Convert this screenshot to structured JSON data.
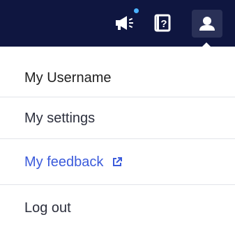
{
  "topbar": {
    "icons": [
      {
        "name": "megaphone-icon"
      },
      {
        "name": "help-book-icon"
      },
      {
        "name": "user-icon"
      }
    ],
    "notification_dot_color": "#4bb3ff",
    "background_color": "#0f1640"
  },
  "menu": {
    "username": "My Username",
    "items": [
      {
        "label": "My settings"
      },
      {
        "label": "My feedback",
        "external": true,
        "color": "#3b5bdb"
      },
      {
        "label": "Log out"
      }
    ]
  }
}
